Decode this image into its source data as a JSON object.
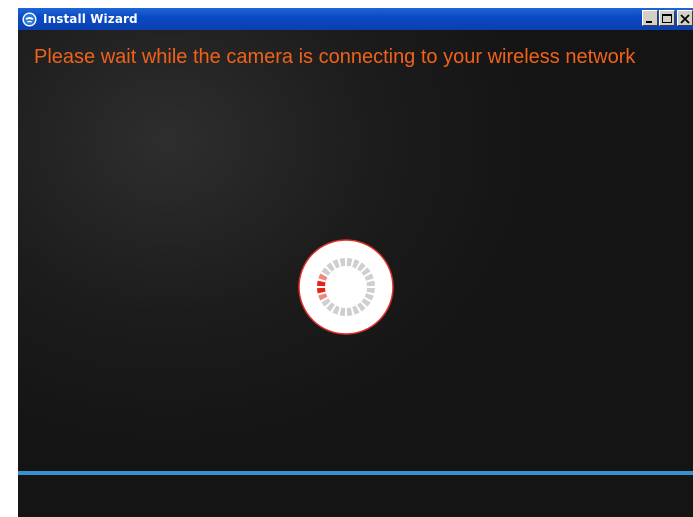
{
  "window": {
    "title": "Install Wizard",
    "title_icon": "app-globe-icon",
    "buttons": {
      "minimize": "minimize-icon",
      "maximize": "maximize-icon",
      "close": "close-icon"
    }
  },
  "main": {
    "message": "Please wait while the camera is connecting to your wireless network"
  },
  "colors": {
    "message_text": "#f0621a",
    "background": "#141414",
    "titlebar": "#0a4ac6",
    "accent_line": "#3a8fd0",
    "spinner_ring": "#e0302a",
    "spinner_active": "#e8201a",
    "spinner_inactive": "#cfcfcf"
  }
}
